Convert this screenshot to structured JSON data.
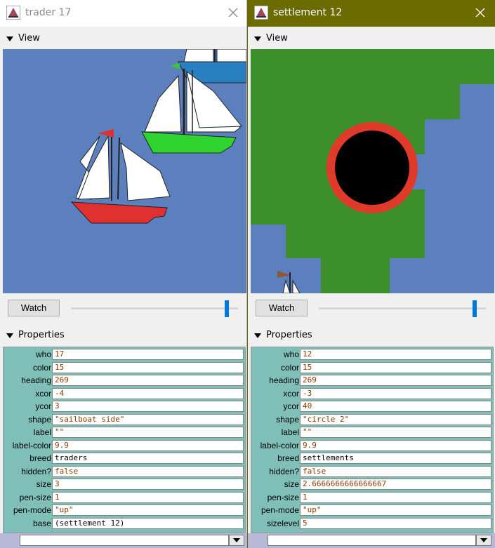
{
  "window1": {
    "title": "trader 17",
    "view_label": "View",
    "watch_label": "Watch",
    "properties_label": "Properties",
    "properties": [
      {
        "name": "who",
        "value": "17",
        "style": "code"
      },
      {
        "name": "color",
        "value": "15",
        "style": "code"
      },
      {
        "name": "heading",
        "value": "269",
        "style": "code"
      },
      {
        "name": "xcor",
        "value": "-4",
        "style": "code"
      },
      {
        "name": "ycor",
        "value": "3",
        "style": "code"
      },
      {
        "name": "shape",
        "value": "\"sailboat side\"",
        "style": "code"
      },
      {
        "name": "label",
        "value": "\"\"",
        "style": "code"
      },
      {
        "name": "label-color",
        "value": "9.9",
        "style": "code"
      },
      {
        "name": "breed",
        "value": "traders",
        "style": "plain"
      },
      {
        "name": "hidden?",
        "value": "false",
        "style": "code"
      },
      {
        "name": "size",
        "value": "3",
        "style": "code"
      },
      {
        "name": "pen-size",
        "value": "1",
        "style": "code"
      },
      {
        "name": "pen-mode",
        "value": "\"up\"",
        "style": "code"
      },
      {
        "name": "base",
        "value": "(settlement 12)",
        "style": "plain"
      }
    ],
    "command_value": ""
  },
  "window2": {
    "title": "settlement 12",
    "view_label": "View",
    "watch_label": "Watch",
    "properties_label": "Properties",
    "properties": [
      {
        "name": "who",
        "value": "12",
        "style": "code"
      },
      {
        "name": "color",
        "value": "15",
        "style": "code"
      },
      {
        "name": "heading",
        "value": "269",
        "style": "code"
      },
      {
        "name": "xcor",
        "value": "-3",
        "style": "code"
      },
      {
        "name": "ycor",
        "value": "40",
        "style": "code"
      },
      {
        "name": "shape",
        "value": "\"circle 2\"",
        "style": "code"
      },
      {
        "name": "label",
        "value": "\"\"",
        "style": "code"
      },
      {
        "name": "label-color",
        "value": "9.9",
        "style": "code"
      },
      {
        "name": "breed",
        "value": "settlements",
        "style": "plain"
      },
      {
        "name": "hidden?",
        "value": "false",
        "style": "code"
      },
      {
        "name": "size",
        "value": "2.6666666666666667",
        "style": "code"
      },
      {
        "name": "pen-size",
        "value": "1",
        "style": "code"
      },
      {
        "name": "pen-mode",
        "value": "\"up\"",
        "style": "code"
      },
      {
        "name": "sizelevel",
        "value": "5",
        "style": "code"
      }
    ],
    "command_value": ""
  },
  "colors": {
    "sea": "#5c7fbe",
    "land": "#3d8f2c",
    "active_titlebar": "#6b6b00",
    "properties_bg": "#7fbfb7",
    "value_text": "#8b3a00"
  },
  "icons": [
    "netlogo-app-icon",
    "close-icon",
    "collapse-triangle-icon",
    "dropdown-arrow-icon"
  ]
}
